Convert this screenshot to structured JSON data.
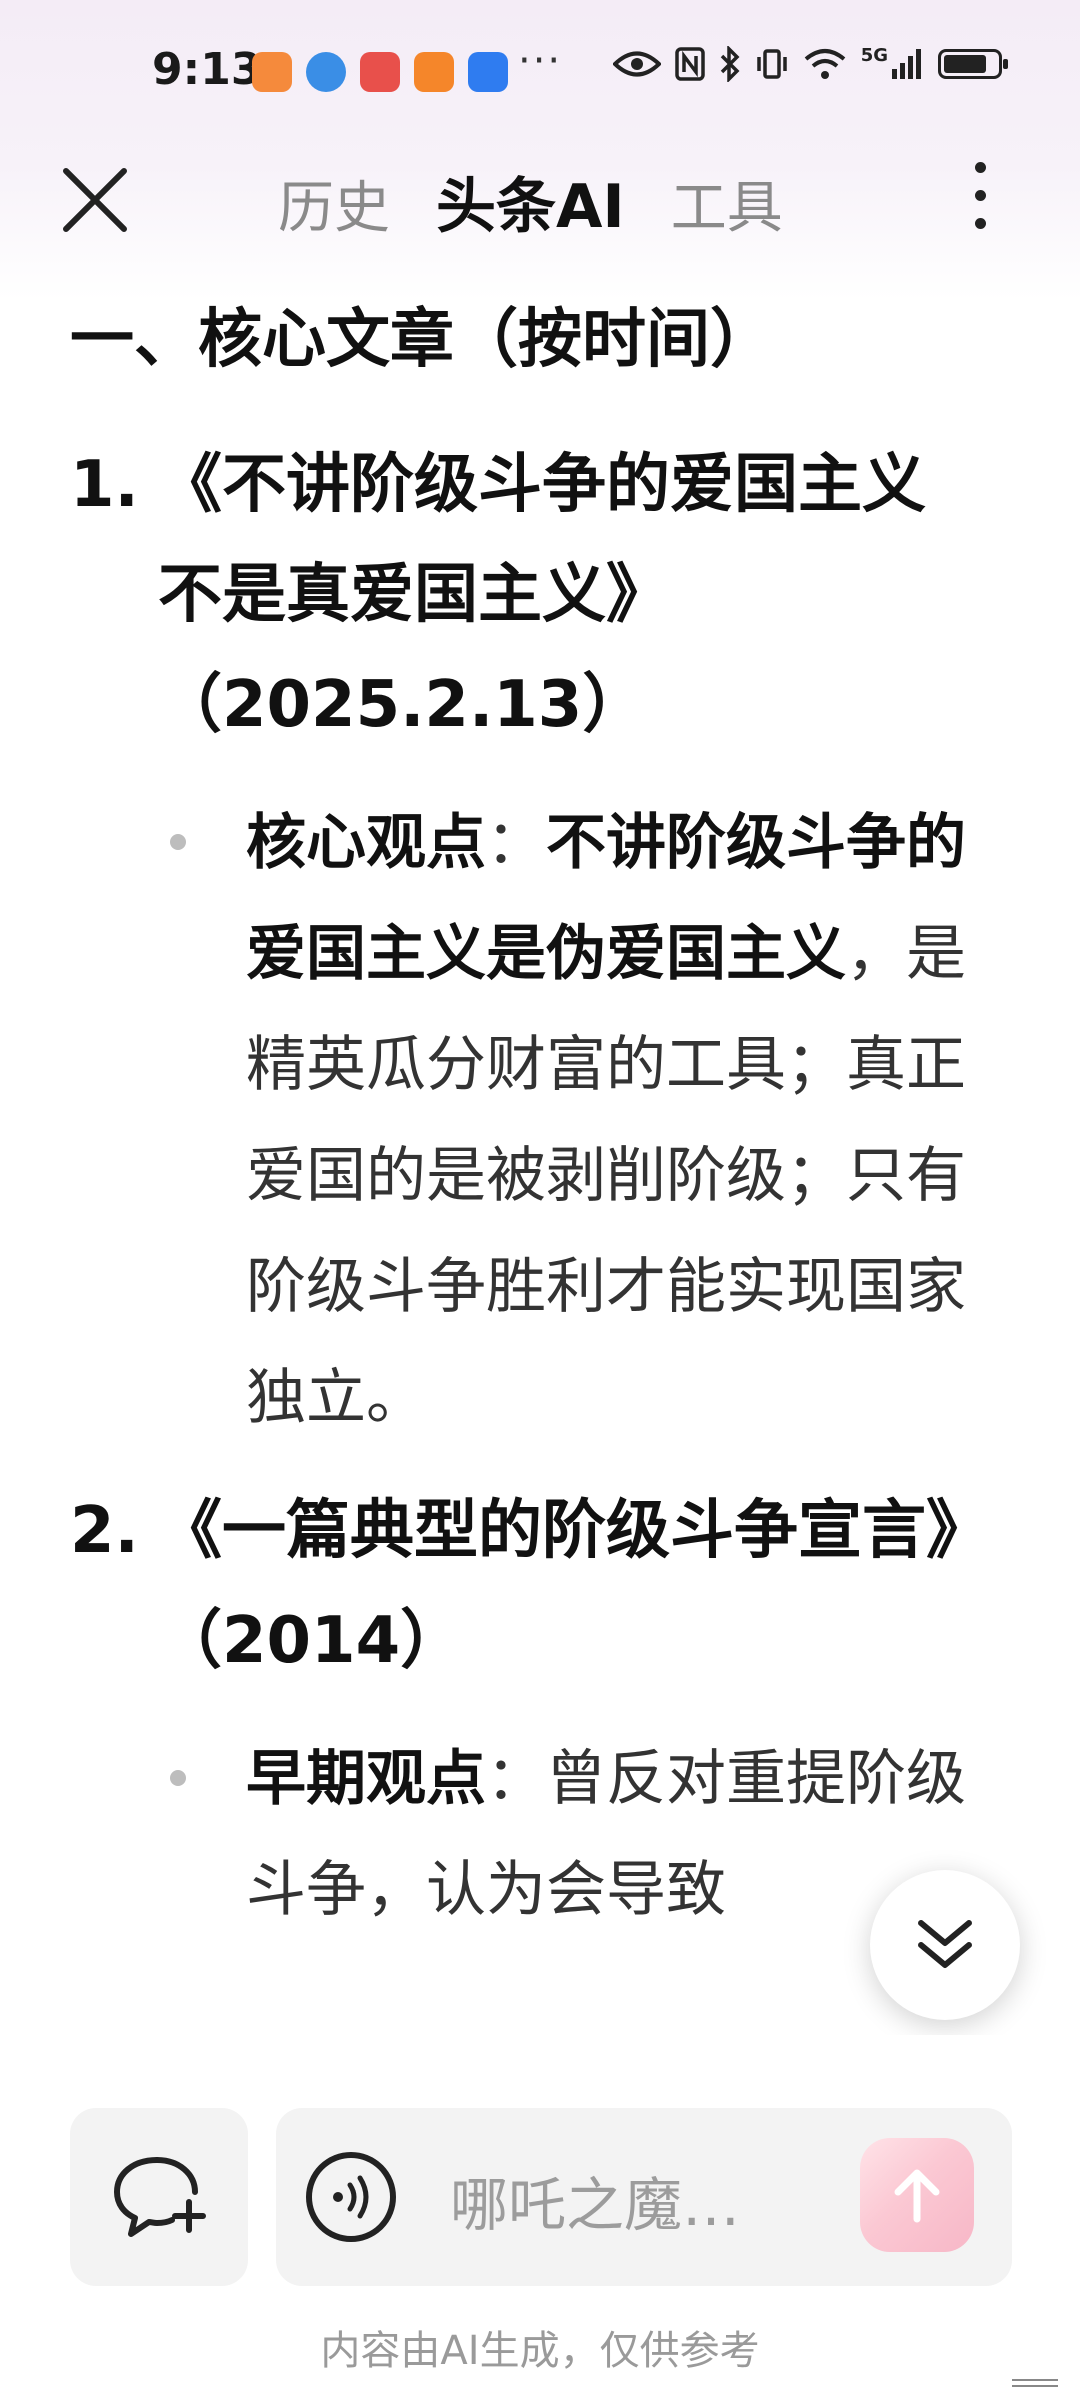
{
  "status_bar": {
    "time": "9:13",
    "more": "···",
    "network": "5G"
  },
  "header": {
    "tabs": [
      {
        "label": "历史",
        "active": false
      },
      {
        "label": "头条AI",
        "active": true
      },
      {
        "label": "工具",
        "active": false
      }
    ]
  },
  "article": {
    "section_heading": "一、核心文章（按时间）",
    "items": [
      {
        "number": "1.",
        "title": "《不讲阶级斗争的爱国主义不是真爱国主义》（2025.2.13）",
        "bullet_label": "核心观点",
        "bullet_sep": "：",
        "bullet_emph": "不讲阶级斗争的爱国主义是伪爱国主义",
        "bullet_text": "，是精英瓜分财富的工具；真正爱国的是被剥削阶级；只有阶级斗争胜利才能实现国家独立。"
      },
      {
        "number": "2.",
        "title": "《一篇典型的阶级斗争宣言》（2014）",
        "bullet_label": "早期观点",
        "bullet_sep": "：",
        "bullet_text": "曾反对重提阶级斗争，认为会导致"
      }
    ]
  },
  "input": {
    "placeholder": "哪吒之魔…"
  },
  "footer": {
    "disclaimer": "内容由AI生成，仅供参考"
  },
  "colors": {
    "accent_send": "#f7b7c7",
    "tab_inactive": "#8a8a8a",
    "text_primary": "#111111"
  }
}
